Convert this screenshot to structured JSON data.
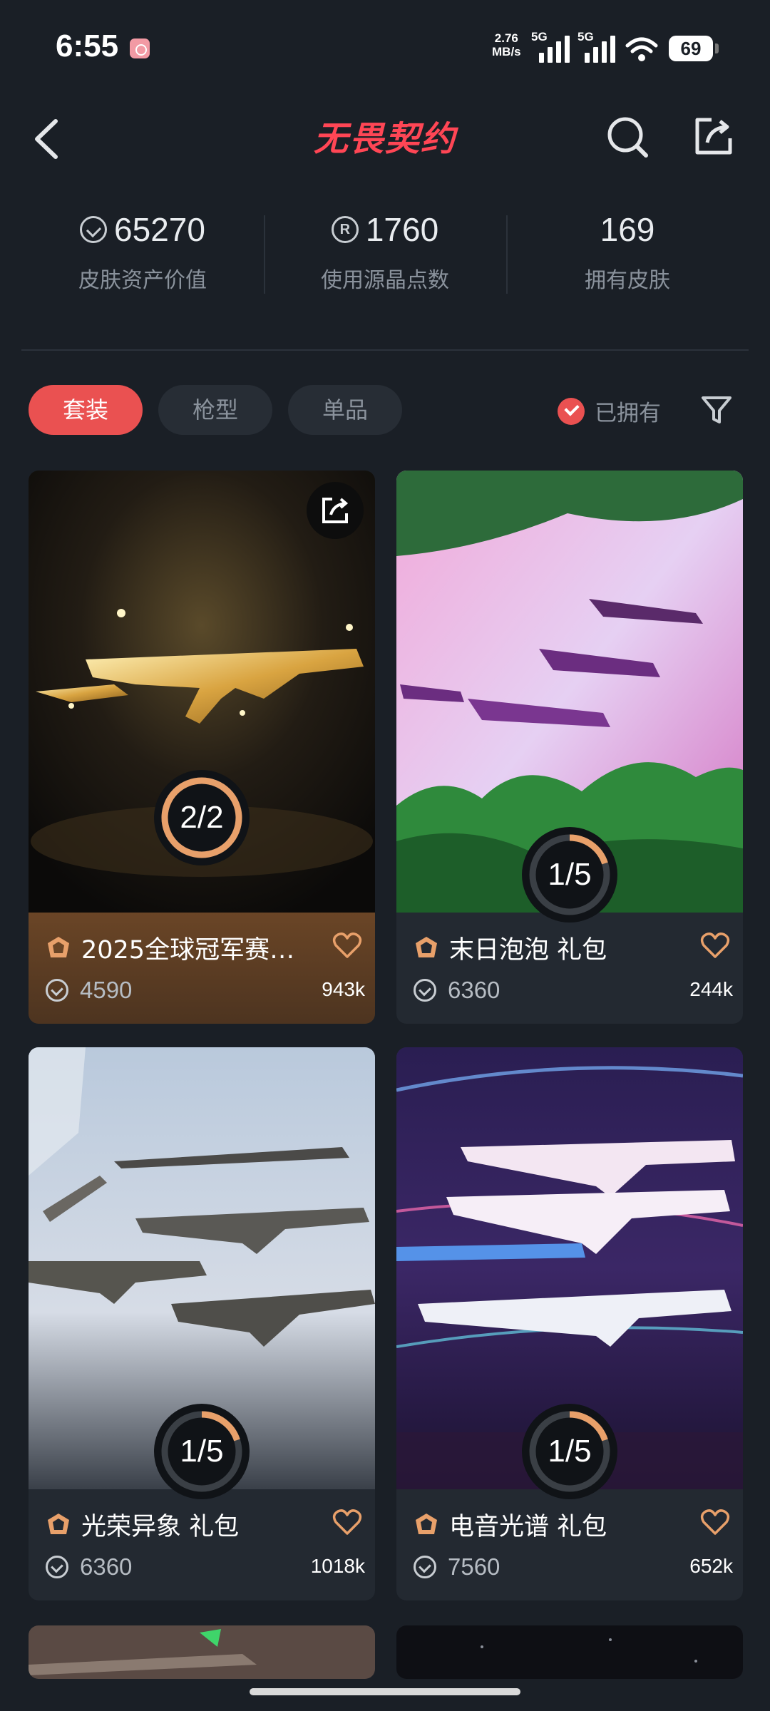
{
  "status_bar": {
    "time": "6:55",
    "net_speed_value": "2.76",
    "net_speed_unit": "MB/s",
    "sig1_label": "5G",
    "sig2_label": "5G",
    "battery": "69"
  },
  "header": {
    "title": "无畏契约"
  },
  "stats": [
    {
      "value": "65270",
      "label": "皮肤资产价值",
      "icon": "vp-coin-icon"
    },
    {
      "value": "1760",
      "label": "使用源晶点数",
      "icon": "radianite-icon"
    },
    {
      "value": "169",
      "label": "拥有皮肤",
      "icon": ""
    }
  ],
  "filters": {
    "chips": [
      "套装",
      "枪型",
      "单品"
    ],
    "active_index": 0,
    "owned_label": "已拥有",
    "owned_checked": true
  },
  "cards": [
    {
      "name": "2025全球冠军赛…",
      "price": "4590",
      "likes": "943k",
      "owned": 2,
      "total": 2,
      "progress_text": "2/2"
    },
    {
      "name": "末日泡泡 礼包",
      "price": "6360",
      "likes": "244k",
      "owned": 1,
      "total": 5,
      "progress_text": "1/5"
    },
    {
      "name": "光荣异象 礼包",
      "price": "6360",
      "likes": "1018k",
      "owned": 1,
      "total": 5,
      "progress_text": "1/5"
    },
    {
      "name": "电音光谱 礼包",
      "price": "7560",
      "likes": "652k",
      "owned": 1,
      "total": 5,
      "progress_text": "1/5"
    }
  ],
  "colors": {
    "accent": "#ea5151",
    "background": "#1a1f26",
    "progress": "#e8a06a"
  }
}
